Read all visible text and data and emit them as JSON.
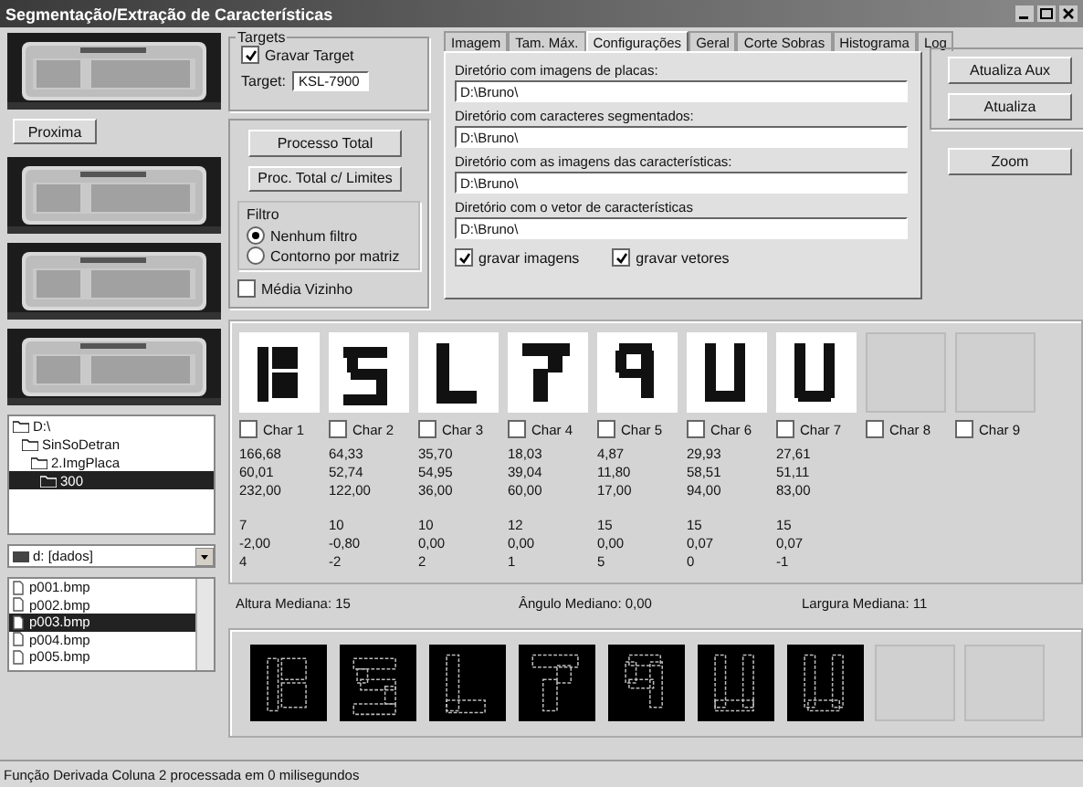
{
  "window": {
    "title": "Segmentação/Extração de Características"
  },
  "plates": [
    {
      "kind": "picture"
    },
    {
      "kind": "picture"
    },
    {
      "kind": "picture"
    },
    {
      "kind": "picture"
    }
  ],
  "next_button": "Proxima",
  "tree": [
    {
      "label": "D:\\",
      "selected": false,
      "children": [
        {
          "label": "SinSoDetran",
          "selected": false,
          "children": [
            {
              "label": "2.ImgPlaca",
              "selected": false,
              "children": [
                {
                  "label": "300",
                  "selected": true
                }
              ]
            }
          ]
        }
      ]
    }
  ],
  "drive": "d: [dados]",
  "files": [
    {
      "name": "p001.bmp",
      "selected": false
    },
    {
      "name": "p002.bmp",
      "selected": false
    },
    {
      "name": "p003.bmp",
      "selected": true
    },
    {
      "name": "p004.bmp",
      "selected": false
    },
    {
      "name": "p005.bmp",
      "selected": false
    }
  ],
  "targets": {
    "title": "Targets",
    "save_label": "Gravar Target",
    "save_checked": true,
    "target_label": "Target:",
    "target_value": "KSL-7900"
  },
  "actions": [
    "Processo Total",
    "Proc. Total c/ Limites"
  ],
  "filter": {
    "title": "Filtro",
    "options": [
      {
        "label": "Nenhum filtro",
        "selected": true
      },
      {
        "label": "Contorno por matriz",
        "selected": false
      }
    ]
  },
  "neighbor_mean": {
    "label": "Média Vizinho",
    "checked": false
  },
  "tabs": [
    {
      "label": "Imagem",
      "selected": false
    },
    {
      "label": "Tam. Máx.",
      "selected": false
    },
    {
      "label": "Configurações",
      "selected": true
    },
    {
      "label": "Geral",
      "selected": false
    },
    {
      "label": "Corte Sobras",
      "selected": false
    },
    {
      "label": "Histograma",
      "selected": false
    },
    {
      "label": "Log",
      "selected": false
    }
  ],
  "directories": [
    {
      "label": "Diretório com imagens de placas:",
      "value": "D:\\Bruno\\"
    },
    {
      "label": "Diretório com caracteres segmentados:",
      "value": "D:\\Bruno\\"
    },
    {
      "label": "Diretório com as imagens das características:",
      "value": "D:\\Bruno\\"
    },
    {
      "label": "Diretório com o vetor de características",
      "value": "D:\\Bruno\\"
    }
  ],
  "save_options": [
    {
      "label": "gravar imagens",
      "checked": true
    },
    {
      "label": "gravar vetores",
      "checked": true
    }
  ],
  "side_buttons": [
    "Atualiza Aux",
    "Atualiza"
  ],
  "zoom_button": "Zoom",
  "chars": [
    {
      "label": "Char 1",
      "checked": false,
      "kind": "picture",
      "stats_a": [
        "166,68",
        "60,01",
        "232,00"
      ],
      "stats_b": [
        "7",
        "-2,00",
        "4"
      ]
    },
    {
      "label": "Char 2",
      "checked": false,
      "kind": "picture",
      "stats_a": [
        "64,33",
        "52,74",
        "122,00"
      ],
      "stats_b": [
        "10",
        "-0,80",
        "-2"
      ]
    },
    {
      "label": "Char 3",
      "checked": false,
      "kind": "picture",
      "stats_a": [
        "35,70",
        "54,95",
        "36,00"
      ],
      "stats_b": [
        "10",
        "0,00",
        "2"
      ]
    },
    {
      "label": "Char 4",
      "checked": false,
      "kind": "picture",
      "stats_a": [
        "18,03",
        "39,04",
        "60,00"
      ],
      "stats_b": [
        "12",
        "0,00",
        "1"
      ]
    },
    {
      "label": "Char 5",
      "checked": false,
      "kind": "picture",
      "stats_a": [
        "4,87",
        "11,80",
        "17,00"
      ],
      "stats_b": [
        "15",
        "0,00",
        "5"
      ]
    },
    {
      "label": "Char 6",
      "checked": false,
      "kind": "picture",
      "stats_a": [
        "29,93",
        "58,51",
        "94,00"
      ],
      "stats_b": [
        "15",
        "0,07",
        "0"
      ]
    },
    {
      "label": "Char 7",
      "checked": false,
      "kind": "picture",
      "stats_a": [
        "27,61",
        "51,11",
        "83,00"
      ],
      "stats_b": [
        "15",
        "0,07",
        "-1"
      ]
    },
    {
      "label": "Char 8",
      "checked": false,
      "kind": "empty"
    },
    {
      "label": "Char 9",
      "checked": false,
      "kind": "empty"
    }
  ],
  "medians": [
    "Altura Mediana: 15",
    "Ângulo Mediano: 0,00",
    "Largura Mediana: 11"
  ],
  "outlines": [
    {
      "kind": "picture"
    },
    {
      "kind": "picture"
    },
    {
      "kind": "picture"
    },
    {
      "kind": "picture"
    },
    {
      "kind": "picture"
    },
    {
      "kind": "picture"
    },
    {
      "kind": "picture"
    },
    {
      "kind": "empty"
    },
    {
      "kind": "empty"
    }
  ],
  "status_bar": "Função Derivada Coluna 2 processada em 0 milisegundos"
}
